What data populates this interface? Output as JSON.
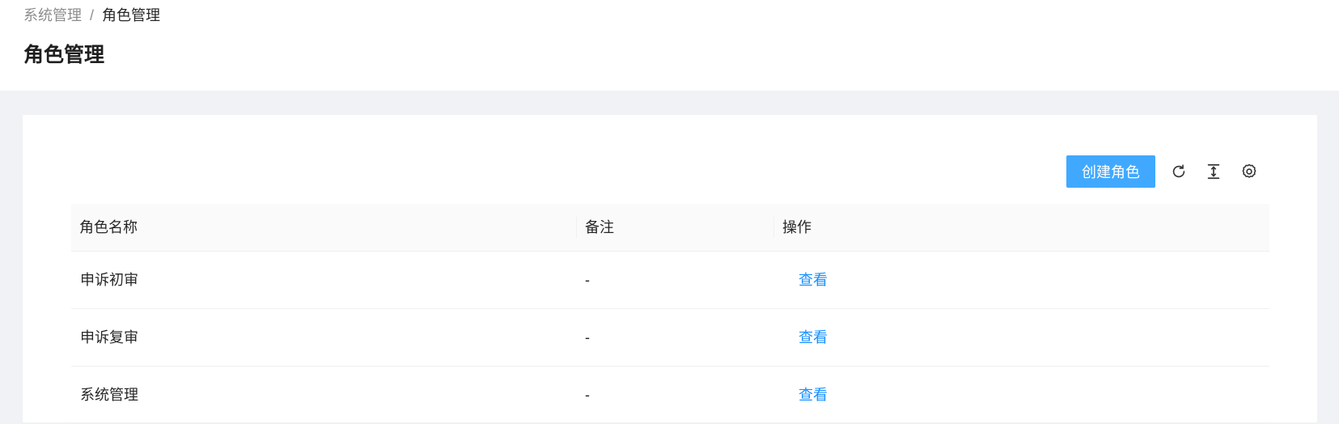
{
  "breadcrumb": {
    "parent": "系统管理",
    "separator": "/",
    "current": "角色管理"
  },
  "page": {
    "title": "角色管理"
  },
  "toolbar": {
    "create_label": "创建角色",
    "icons": [
      "reload-icon",
      "column-height-icon",
      "setting-icon"
    ]
  },
  "table": {
    "columns": [
      "角色名称",
      "备注",
      "操作"
    ],
    "rows": [
      {
        "name": "申诉初审",
        "remark": "-",
        "action": "查看"
      },
      {
        "name": "申诉复审",
        "remark": "-",
        "action": "查看"
      },
      {
        "name": "系统管理",
        "remark": "-",
        "action": "查看"
      }
    ]
  },
  "colors": {
    "primary": "#40a9ff",
    "link": "#1890ff",
    "background": "#f0f2f5"
  }
}
